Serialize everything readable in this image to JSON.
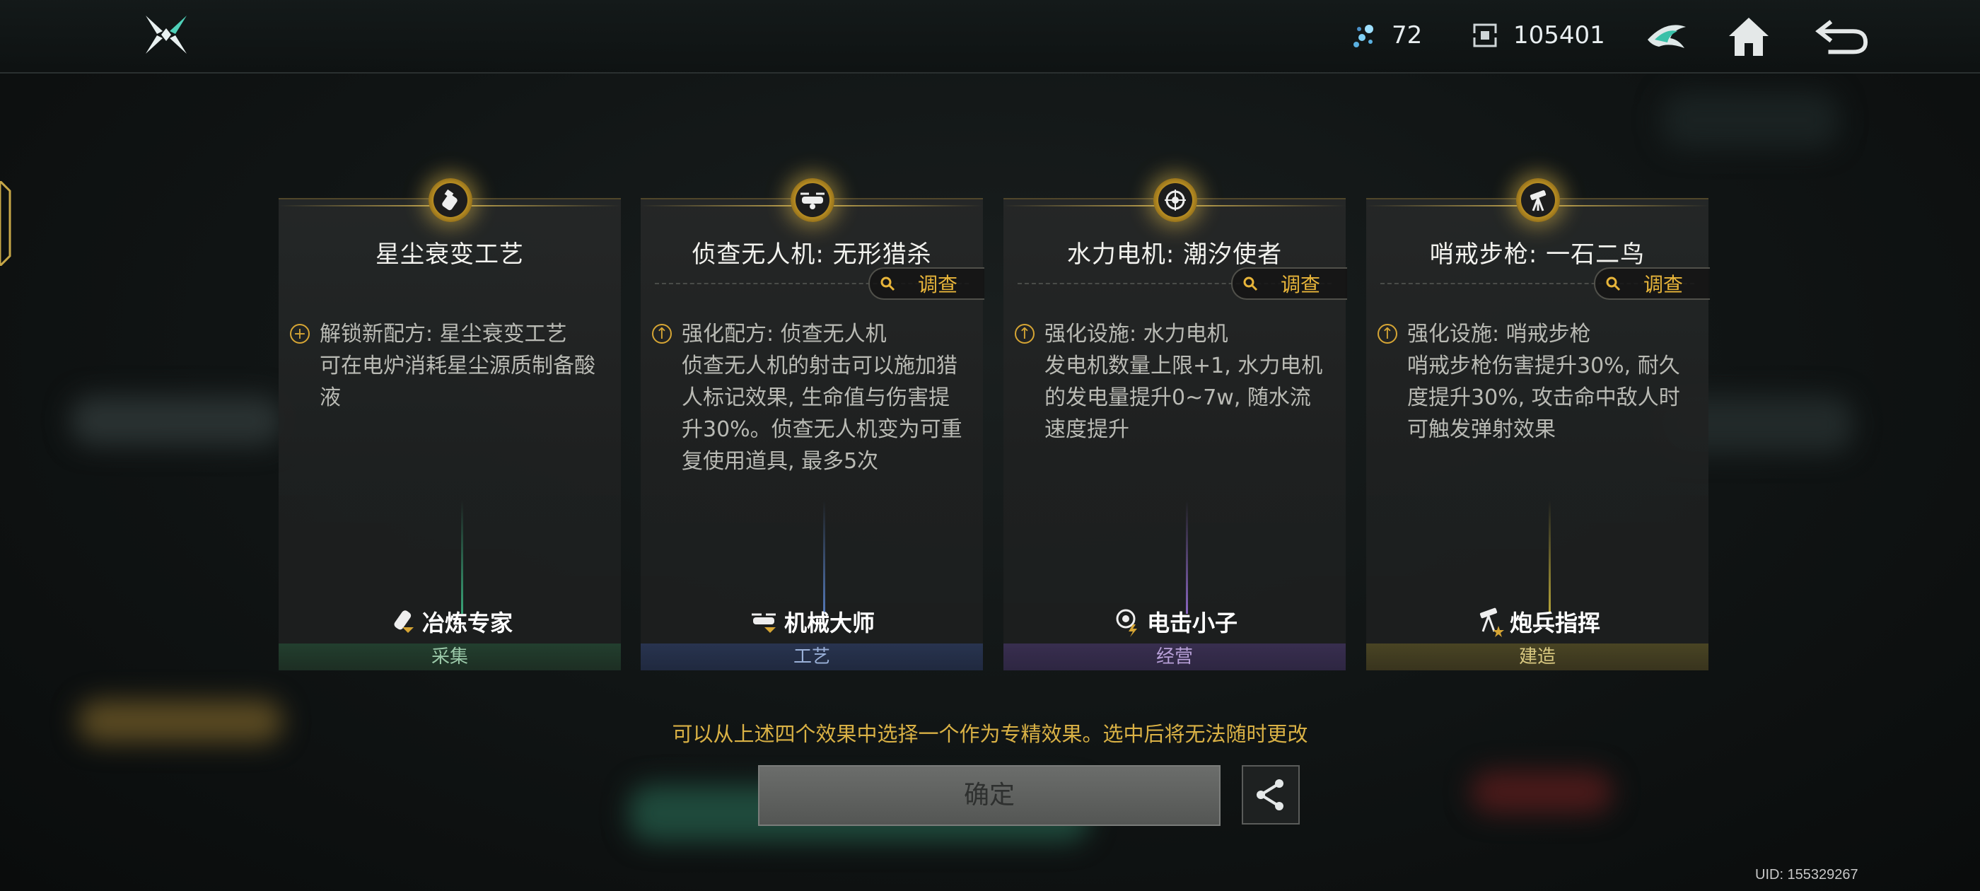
{
  "topbar": {
    "currency_1": "72",
    "currency_2": "105401"
  },
  "cards": [
    {
      "title": "星尘衰变工艺",
      "has_investigate": false,
      "desc_head": "解锁新配方: 星尘衰变工艺",
      "desc_body": "可在电炉消耗星尘源质制备酸液",
      "bullet": "+",
      "role": "冶炼专家",
      "category": "采集",
      "accent": "#3a9a6a"
    },
    {
      "title": "侦查无人机: 无形猎杀",
      "has_investigate": true,
      "investigate_label": "调查",
      "desc_head": "强化配方: 侦查无人机",
      "desc_body": "侦查无人机的射击可以施加猎人标记效果, 生命值与伤害提升30%。侦查无人机变为可重复使用道具, 最多5次",
      "bullet": "↑",
      "role": "机械大师",
      "category": "工艺",
      "accent": "#4a70b8"
    },
    {
      "title": "水力电机: 潮汐使者",
      "has_investigate": true,
      "investigate_label": "调查",
      "desc_head": "强化设施: 水力电机",
      "desc_body": "发电机数量上限+1, 水力电机的发电量提升0~7w, 随水流速度提升",
      "bullet": "↑",
      "role": "电击小子",
      "category": "经营",
      "accent": "#7a5ab8"
    },
    {
      "title": "哨戒步枪: 一石二鸟",
      "has_investigate": true,
      "investigate_label": "调查",
      "desc_head": "强化设施: 哨戒步枪",
      "desc_body": "哨戒步枪伤害提升30%, 耐久度提升30%, 攻击命中敌人时可触发弹射效果",
      "bullet": "↑",
      "role": "炮兵指挥",
      "category": "建造",
      "accent": "#b8a030"
    }
  ],
  "hint": "可以从上述四个效果中选择一个作为专精效果。选中后将无法随时更改",
  "confirm_label": "确定",
  "uid": "UID: 155329267"
}
